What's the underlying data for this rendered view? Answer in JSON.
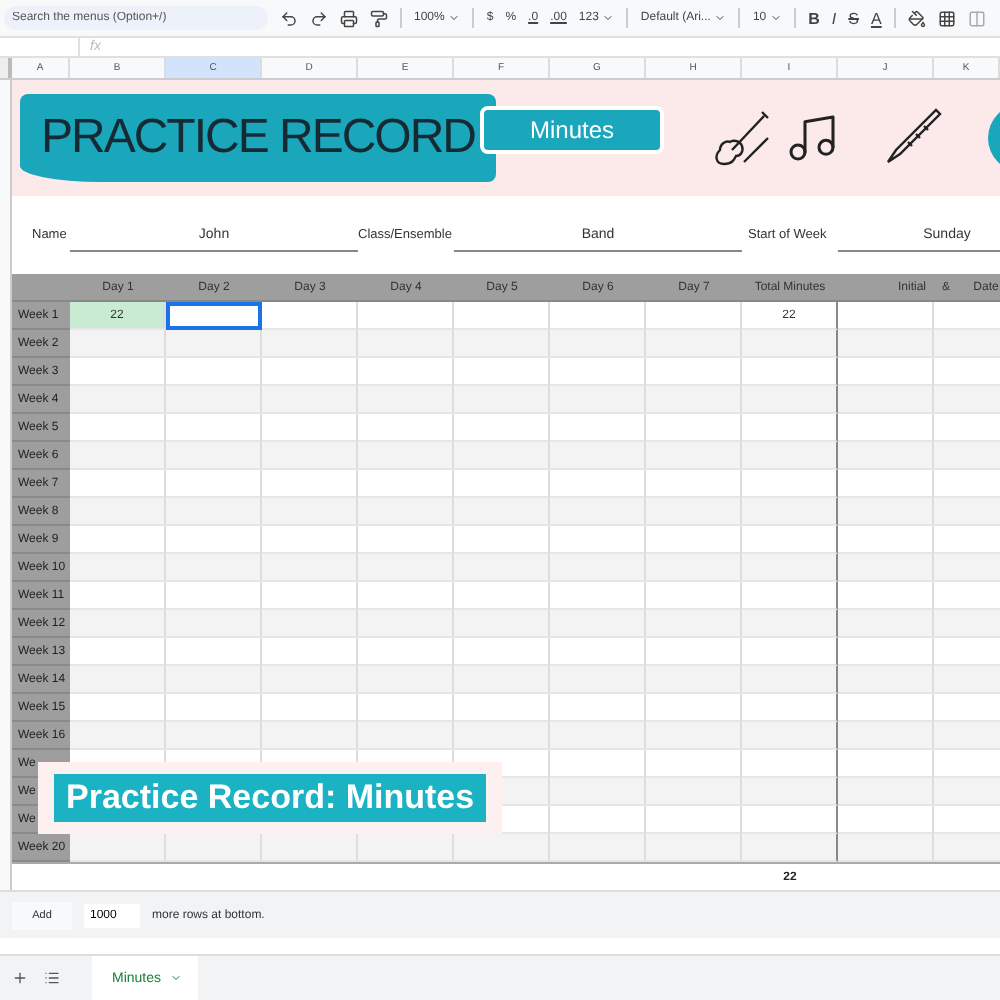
{
  "toolbar": {
    "search": {
      "placeholder": "Search the menus (Option+/)"
    },
    "zoom": "100%",
    "currency": "$",
    "percent": "%",
    "decimal_less": ".0",
    "decimal_more": ".00",
    "number_format": "123",
    "font": "Default (Ari...",
    "font_size": "10",
    "bold": "B",
    "italic": "I",
    "strikethrough": "S",
    "text_color": "A"
  },
  "formula_bar": {
    "fx": "fx"
  },
  "columns": [
    {
      "label": "A",
      "selected": false
    },
    {
      "label": "B",
      "selected": false
    },
    {
      "label": "C",
      "selected": true
    },
    {
      "label": "D",
      "selected": false
    },
    {
      "label": "E",
      "selected": false
    },
    {
      "label": "F",
      "selected": false
    },
    {
      "label": "G",
      "selected": false
    },
    {
      "label": "H",
      "selected": false
    },
    {
      "label": "I",
      "selected": false
    },
    {
      "label": "J",
      "selected": false
    },
    {
      "label": "K",
      "selected": false
    }
  ],
  "banner": {
    "title": "PRACTICE RECORD",
    "subtitle": "Minutes"
  },
  "fields": [
    {
      "label": "Name",
      "value": "John"
    },
    {
      "label": "Class/Ensemble",
      "value": "Band"
    },
    {
      "label": "Start of Week",
      "value": "Sunday"
    }
  ],
  "table": {
    "headers": [
      "Day 1",
      "Day 2",
      "Day 3",
      "Day 4",
      "Day 5",
      "Day 6",
      "Day 7",
      "Total Minutes",
      "Initial",
      "& Date"
    ],
    "rows": [
      {
        "label": "Week 1",
        "days": [
          {
            "value": "22",
            "selected": false
          },
          {
            "selected": true
          }
        ],
        "total": "22"
      },
      {
        "label": "Week 2"
      },
      {
        "label": "Week 3"
      },
      {
        "label": "Week 4"
      },
      {
        "label": "Week 5"
      },
      {
        "label": "Week 6"
      },
      {
        "label": "Week 7"
      },
      {
        "label": "Week 8"
      },
      {
        "label": "Week 9"
      },
      {
        "label": "Week 10"
      },
      {
        "label": "Week 11"
      },
      {
        "label": "Week 12"
      },
      {
        "label": "Week 13"
      },
      {
        "label": "Week 14"
      },
      {
        "label": "Week 15"
      },
      {
        "label": "Week 16"
      },
      {
        "label": "We"
      },
      {
        "label": "We"
      },
      {
        "label": "We"
      },
      {
        "label": "Week 20"
      }
    ],
    "grand_total": "22"
  },
  "add_rows": {
    "button": "Add",
    "value": "1000",
    "text": "more rows at bottom."
  },
  "sheet_tabs": [
    {
      "label": "Minutes",
      "selected": true
    }
  ],
  "caption": "Practice Record: Minutes"
}
